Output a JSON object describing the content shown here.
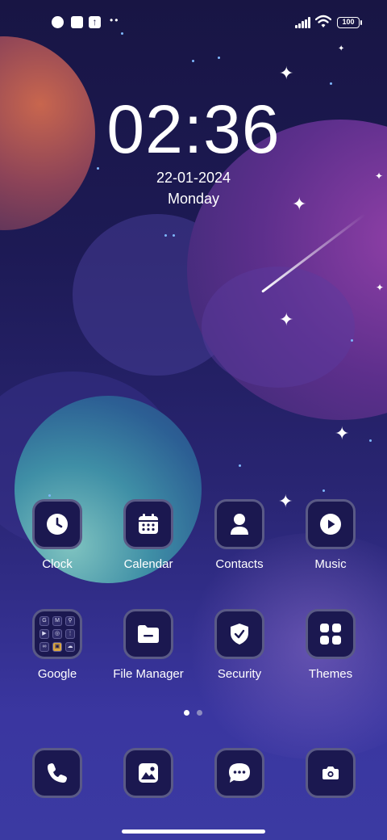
{
  "status_bar": {
    "battery": "100",
    "icons": [
      "notification-icon",
      "square-icon",
      "upload-icon",
      "more-dots-icon",
      "signal-icon",
      "wifi-icon",
      "battery-icon"
    ]
  },
  "clock_widget": {
    "time": "02:36",
    "date": "22-01-2024",
    "day": "Monday"
  },
  "apps_row1": [
    {
      "label": "Clock",
      "icon": "clock-icon"
    },
    {
      "label": "Calendar",
      "icon": "calendar-icon"
    },
    {
      "label": "Contacts",
      "icon": "contact-icon"
    },
    {
      "label": "Music",
      "icon": "play-icon"
    }
  ],
  "apps_row2": [
    {
      "label": "Google",
      "icon": "google-folder-icon"
    },
    {
      "label": "File Manager",
      "icon": "folder-icon"
    },
    {
      "label": "Security",
      "icon": "shield-icon"
    },
    {
      "label": "Themes",
      "icon": "themes-grid-icon"
    }
  ],
  "google_folder": [
    "G",
    "M",
    "⚲",
    "▶",
    "◎",
    "⋮",
    "∞",
    "▣",
    "☁"
  ],
  "dock": [
    {
      "icon": "phone-icon"
    },
    {
      "icon": "gallery-icon"
    },
    {
      "icon": "messages-icon"
    },
    {
      "icon": "camera-icon"
    }
  ],
  "page_indicator": {
    "pages": 2,
    "current": 1
  },
  "colors": {
    "icon_bg": "#1b1850",
    "icon_border": "#5a5a86",
    "text": "#ffffff"
  }
}
